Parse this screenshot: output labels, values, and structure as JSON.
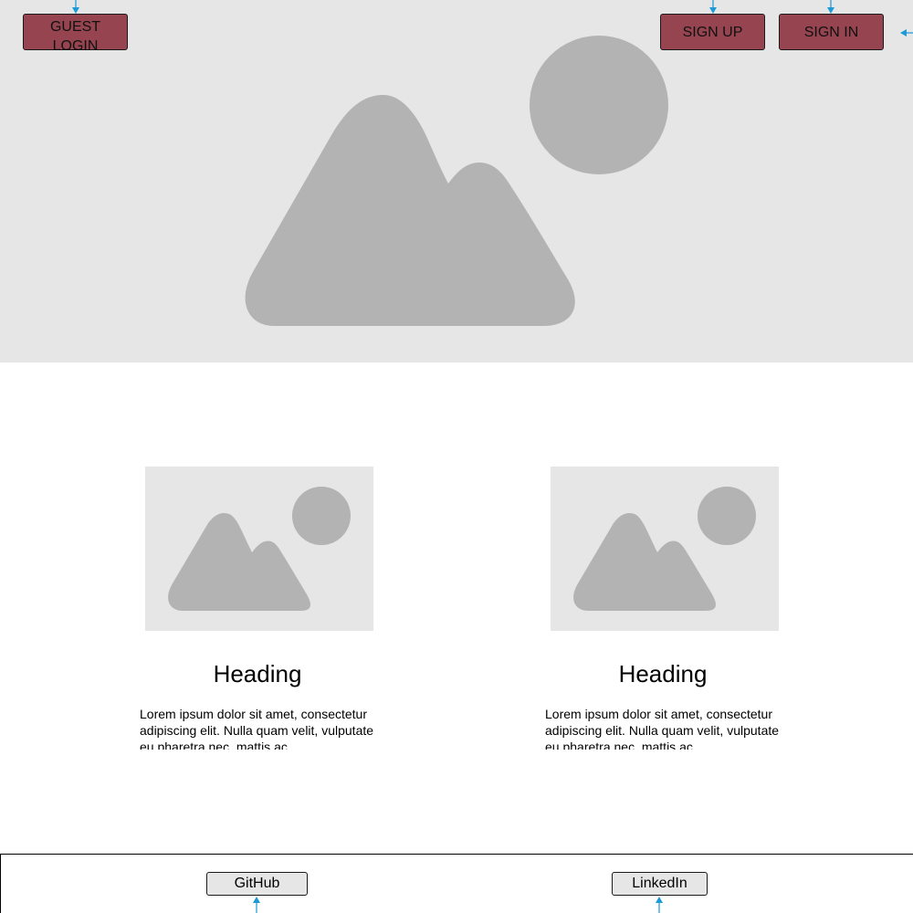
{
  "header": {
    "guest_login_label": "GUEST LOGIN",
    "sign_up_label": "SIGN UP",
    "sign_in_label": "SIGN IN"
  },
  "hero": {
    "image_icon": "image-placeholder-icon"
  },
  "cards": [
    {
      "heading": "Heading",
      "body": "Lorem ipsum dolor sit amet, consectetur adipiscing elit. Nulla quam velit, vulputate eu pharetra nec, mattis ac"
    },
    {
      "heading": "Heading",
      "body": "Lorem ipsum dolor sit amet, consectetur adipiscing elit. Nulla quam velit, vulputate eu pharetra nec, mattis ac"
    }
  ],
  "footer": {
    "github_label": "GitHub",
    "linkedin_label": "LinkedIn"
  },
  "colors": {
    "accent_button": "#954450",
    "placeholder_bg": "#e6e6e6",
    "placeholder_shape": "#b3b3b3",
    "annotation_arrow": "#1a9ad6"
  }
}
